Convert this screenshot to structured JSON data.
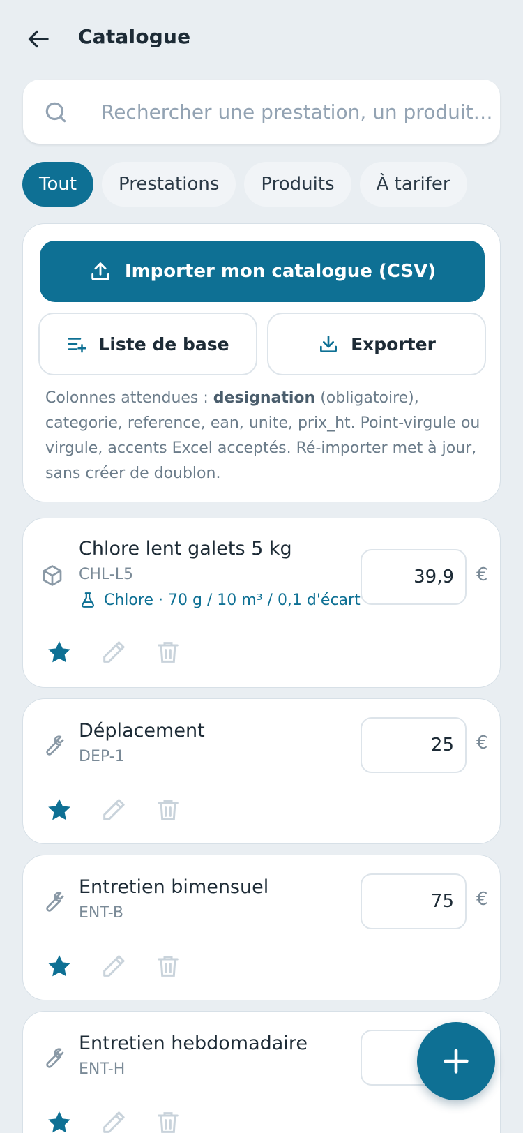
{
  "header": {
    "title": "Catalogue",
    "back_icon": "arrow-left-icon"
  },
  "search": {
    "placeholder": "Rechercher une prestation, un produit…",
    "value": ""
  },
  "filters": [
    {
      "label": "Tout",
      "active": true
    },
    {
      "label": "Prestations",
      "active": false
    },
    {
      "label": "Produits",
      "active": false
    },
    {
      "label": "À tarifer",
      "active": false
    }
  ],
  "import": {
    "import_label": "Importer mon catalogue (CSV)",
    "base_label": "Liste de base",
    "export_label": "Exporter",
    "help_prefix": "Colonnes attendues : ",
    "help_bold": "designation",
    "help_suffix": " (obligatoire), categorie, reference, ean, unite, prix_ht. Point-virgule ou virgule, accents Excel acceptés. Ré-importer met à jour, sans créer de doublon."
  },
  "items": [
    {
      "name": "Chlore lent galets 5 kg",
      "ref": "CHL-L5",
      "type_icon": "box-icon",
      "chemical": "Chlore · 70 g / 10 m³ / 0,1 d'écart",
      "price": "39,9",
      "currency": "€",
      "favorite": true
    },
    {
      "name": "Déplacement",
      "ref": "DEP-1",
      "type_icon": "wrench-icon",
      "price": "25",
      "currency": "€",
      "favorite": true
    },
    {
      "name": "Entretien bimensuel",
      "ref": "ENT-B",
      "type_icon": "wrench-icon",
      "price": "75",
      "currency": "€",
      "favorite": true
    },
    {
      "name": "Entretien hebdomadaire",
      "ref": "ENT-H",
      "type_icon": "wrench-icon",
      "price": "",
      "currency": "€",
      "favorite": true
    }
  ],
  "colors": {
    "primary": "#0e7094",
    "background": "#e9eef2",
    "card": "#ffffff"
  }
}
